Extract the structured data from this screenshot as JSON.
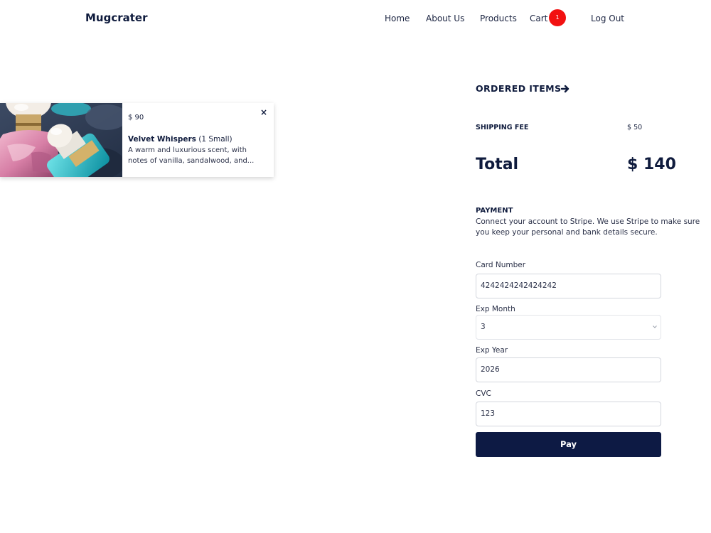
{
  "header": {
    "brand": "Mugcrater",
    "nav": {
      "home": "Home",
      "about": "About Us",
      "products": "Products",
      "cart": "Cart",
      "cart_count": "1",
      "logout": "Log Out"
    }
  },
  "cart_item": {
    "price": "$ 90",
    "name": "Velvet Whispers",
    "variant": "(1 Small)",
    "description": "A warm and luxurious scent, with notes of vanilla, sandalwood, and...",
    "close_icon": "×"
  },
  "summary": {
    "ordered_items_label": "ORDERED ITEMS",
    "shipping_label": "SHIPPING FEE",
    "shipping_value": "$ 50",
    "total_label": "Total",
    "total_value": "$ 140"
  },
  "payment": {
    "title": "PAYMENT",
    "description": "Connect your account to Stripe. We use Stripe to make sure you keep your personal and bank details secure.",
    "card_number_label": "Card Number",
    "card_number_value": "4242424242424242",
    "exp_month_label": "Exp Month",
    "exp_month_value": "3",
    "exp_year_label": "Exp Year",
    "exp_year_value": "2026",
    "cvc_label": "CVC",
    "cvc_value": "123",
    "pay_button": "Pay"
  },
  "colors": {
    "navy": "#0d1a44",
    "badge_red": "#f21111"
  }
}
